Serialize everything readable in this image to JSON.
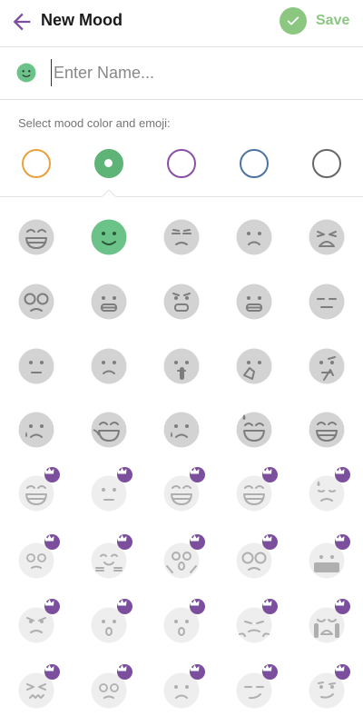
{
  "header": {
    "title": "New Mood",
    "save_label": "Save",
    "back_icon": "arrow-left-icon",
    "save_icon": "check-icon",
    "accent_color": "#7b4f9e",
    "save_color": "#8cc782"
  },
  "name_field": {
    "value": "",
    "placeholder": "Enter Name..."
  },
  "section_label": "Select mood color and emoji:",
  "colors": [
    {
      "name": "orange",
      "hex": "#e7a23d",
      "selected": false
    },
    {
      "name": "green",
      "hex": "#5eb477",
      "selected": true
    },
    {
      "name": "purple",
      "hex": "#8b4fa6",
      "selected": false
    },
    {
      "name": "blue",
      "hex": "#4f73a0",
      "selected": false
    },
    {
      "name": "gray",
      "hex": "#666666",
      "selected": false
    }
  ],
  "emojis": [
    {
      "icon": "grin-icon",
      "locked": false,
      "selected": false
    },
    {
      "icon": "smile-icon",
      "locked": false,
      "selected": true
    },
    {
      "icon": "unamused-icon",
      "locked": false,
      "selected": false
    },
    {
      "icon": "worried-icon",
      "locked": false,
      "selected": false
    },
    {
      "icon": "tired-face-icon",
      "locked": false,
      "selected": false
    },
    {
      "icon": "flushed-glasses-icon",
      "locked": false,
      "selected": false
    },
    {
      "icon": "grimacing-icon",
      "locked": false,
      "selected": false
    },
    {
      "icon": "fearful-icon",
      "locked": false,
      "selected": false
    },
    {
      "icon": "teeth-clenched-icon",
      "locked": false,
      "selected": false
    },
    {
      "icon": "expressionless-icon",
      "locked": false,
      "selected": false
    },
    {
      "icon": "neutral-face-icon",
      "locked": false,
      "selected": false
    },
    {
      "icon": "slightly-frowning-icon",
      "locked": false,
      "selected": false
    },
    {
      "icon": "shushing-icon",
      "locked": false,
      "selected": false
    },
    {
      "icon": "hand-over-mouth-icon",
      "locked": false,
      "selected": false
    },
    {
      "icon": "thinking-icon",
      "locked": false,
      "selected": false
    },
    {
      "icon": "sad-tear-icon",
      "locked": false,
      "selected": false
    },
    {
      "icon": "joy-icon",
      "locked": false,
      "selected": false
    },
    {
      "icon": "crying-icon",
      "locked": false,
      "selected": false
    },
    {
      "icon": "sweat-smile-icon",
      "locked": false,
      "selected": false
    },
    {
      "icon": "laughing-icon",
      "locked": false,
      "selected": false
    },
    {
      "icon": "big-grin-icon",
      "locked": true,
      "selected": false
    },
    {
      "icon": "blank-face-icon",
      "locked": true,
      "selected": false
    },
    {
      "icon": "grin-open-icon",
      "locked": true,
      "selected": false
    },
    {
      "icon": "happy-icon",
      "locked": true,
      "selected": false
    },
    {
      "icon": "disappointed-sweat-icon",
      "locked": true,
      "selected": false
    },
    {
      "icon": "dizzy-icon",
      "locked": true,
      "selected": false
    },
    {
      "icon": "hugging-icon",
      "locked": true,
      "selected": false
    },
    {
      "icon": "screaming-icon",
      "locked": true,
      "selected": false
    },
    {
      "icon": "glasses-surprised-icon",
      "locked": true,
      "selected": false
    },
    {
      "icon": "cursing-icon",
      "locked": true,
      "selected": false
    },
    {
      "icon": "angry-icon",
      "locked": true,
      "selected": false
    },
    {
      "icon": "surprised-icon",
      "locked": true,
      "selected": false
    },
    {
      "icon": "astonished-icon",
      "locked": true,
      "selected": false
    },
    {
      "icon": "triumph-icon",
      "locked": true,
      "selected": false
    },
    {
      "icon": "loudly-crying-icon",
      "locked": true,
      "selected": false
    },
    {
      "icon": "confounded-icon",
      "locked": true,
      "selected": false
    },
    {
      "icon": "dizzy-eyes-icon",
      "locked": true,
      "selected": false
    },
    {
      "icon": "confused-icon",
      "locked": true,
      "selected": false
    },
    {
      "icon": "smirk-icon",
      "locked": true,
      "selected": false
    },
    {
      "icon": "smug-icon",
      "locked": true,
      "selected": false
    }
  ],
  "emoji_tint": {
    "default": "#d3d3d3",
    "locked": "#eeeeee",
    "selected": "#6cc38a",
    "premium_badge": "#7b4f9e"
  }
}
